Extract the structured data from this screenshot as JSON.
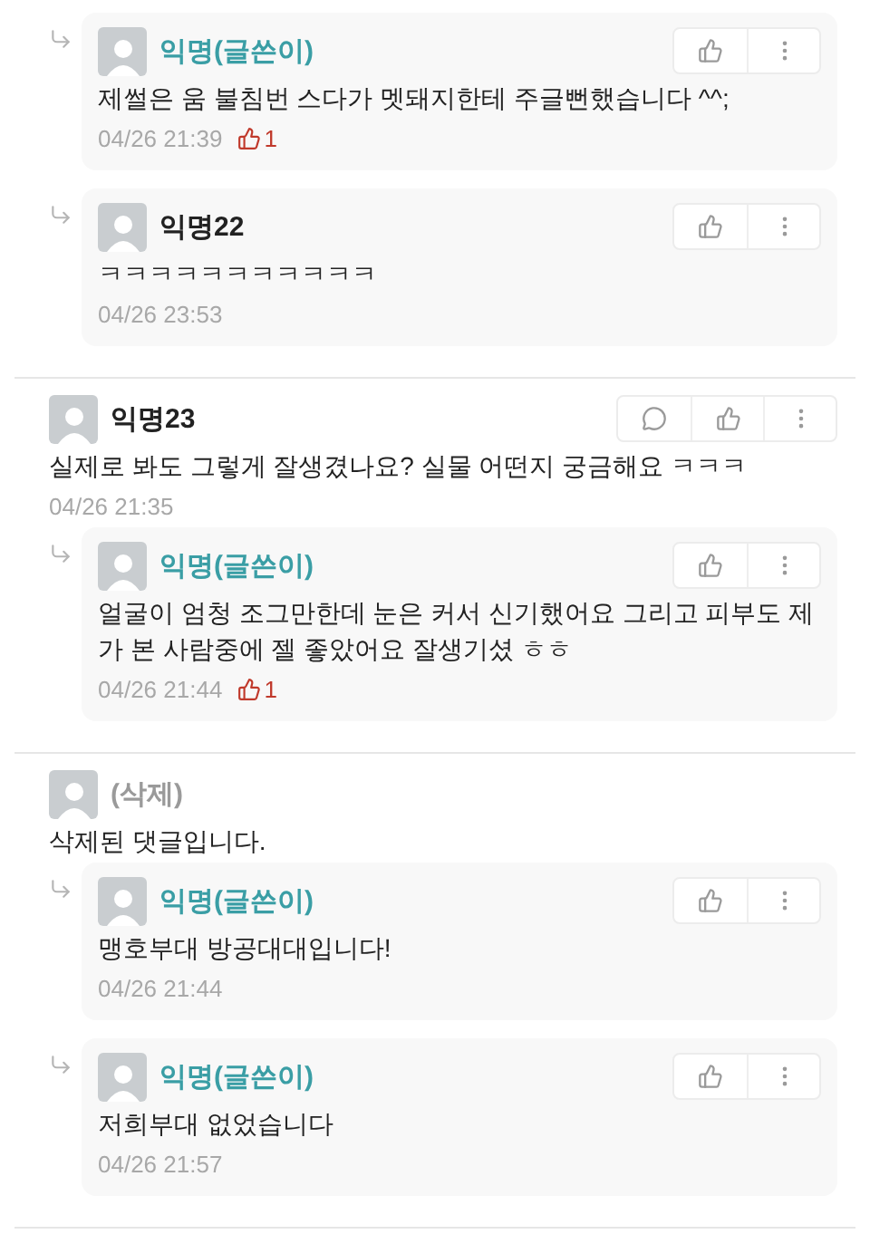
{
  "comments": [
    {
      "kind": "reply",
      "author": "익명(글쓴이)",
      "is_writer": true,
      "deleted": false,
      "body": "제썰은 움 불침번 스다가 멧돼지한테 주글뻔했습니다 ^^;",
      "time": "04/26 21:39",
      "likes": "1"
    },
    {
      "kind": "reply",
      "author": "익명22",
      "is_writer": false,
      "deleted": false,
      "body": "ㅋㅋㅋㅋㅋㅋㅋㅋㅋㅋㅋ",
      "time": "04/26 23:53"
    },
    {
      "kind": "comment",
      "author": "익명23",
      "is_writer": false,
      "deleted": false,
      "body": "실제로 봐도 그렇게 잘생겼나요? 실물 어떤지 궁금해요 ㅋㅋㅋ",
      "time": "04/26 21:35"
    },
    {
      "kind": "reply",
      "author": "익명(글쓴이)",
      "is_writer": true,
      "deleted": false,
      "body": "얼굴이 엄청 조그만한데 눈은 커서 신기했어요 그리고 피부도 제가 본 사람중에 젤 좋았어요 잘생기셨 ㅎㅎ",
      "time": "04/26 21:44",
      "likes": "1"
    },
    {
      "kind": "comment",
      "author": "(삭제)",
      "is_writer": false,
      "deleted": true,
      "body": "삭제된 댓글입니다."
    },
    {
      "kind": "reply",
      "author": "익명(글쓴이)",
      "is_writer": true,
      "deleted": false,
      "body": "맹호부대 방공대대입니다!",
      "time": "04/26 21:44"
    },
    {
      "kind": "reply",
      "author": "익명(글쓴이)",
      "is_writer": true,
      "deleted": false,
      "body": "저희부대 없었습니다",
      "time": "04/26 21:57"
    }
  ]
}
